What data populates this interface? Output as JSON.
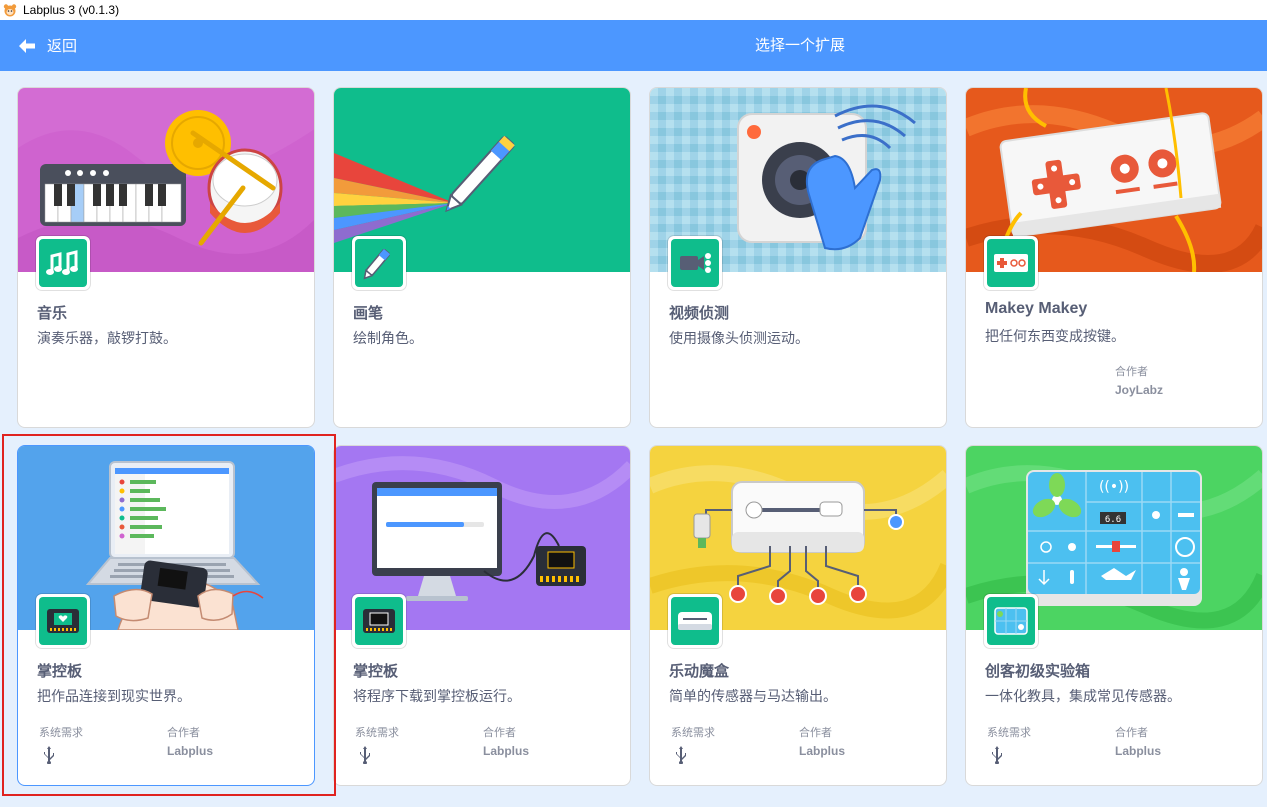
{
  "window": {
    "title": "Labplus 3 (v0.1.3)"
  },
  "header": {
    "back_label": "返回",
    "title": "选择一个扩展"
  },
  "cards": [
    {
      "title": "音乐",
      "description": "演奏乐器，敲锣打鼓。"
    },
    {
      "title": "画笔",
      "description": "绘制角色。"
    },
    {
      "title": "视频侦测",
      "description": "使用摄像头侦测运动。"
    },
    {
      "title": "Makey Makey",
      "description": "把任何东西变成按键。",
      "collaborator_label": "合作者",
      "collaborator": "JoyLabz"
    },
    {
      "title": "掌控板",
      "description": "把作品连接到现实世界。",
      "requirements_label": "系统需求",
      "collaborator_label": "合作者",
      "collaborator": "Labplus",
      "selected": true
    },
    {
      "title": "掌控板",
      "description": "将程序下载到掌控板运行。",
      "requirements_label": "系统需求",
      "collaborator_label": "合作者",
      "collaborator": "Labplus"
    },
    {
      "title": "乐动魔盒",
      "description": "简单的传感器与马达输出。",
      "requirements_label": "系统需求",
      "collaborator_label": "合作者",
      "collaborator": "Labplus"
    },
    {
      "title": "创客初级实验箱",
      "description": "一体化教具，集成常见传感器。",
      "requirements_label": "系统需求",
      "collaborator_label": "合作者",
      "collaborator": "Labplus"
    }
  ],
  "icons": {
    "music": "music-notes-icon",
    "pen": "pen-icon",
    "video": "video-camera-icon",
    "makey": "makey-board-icon",
    "board": "mpython-board-icon",
    "box": "music-box-icon",
    "kit": "experiment-kit-icon",
    "usb": "usb-icon"
  },
  "colors": {
    "header": "#4c97ff",
    "background": "#e5f0fd",
    "text": "#575e75",
    "highlight": "#e0231f",
    "icon_bg": "#0fbd8c"
  }
}
